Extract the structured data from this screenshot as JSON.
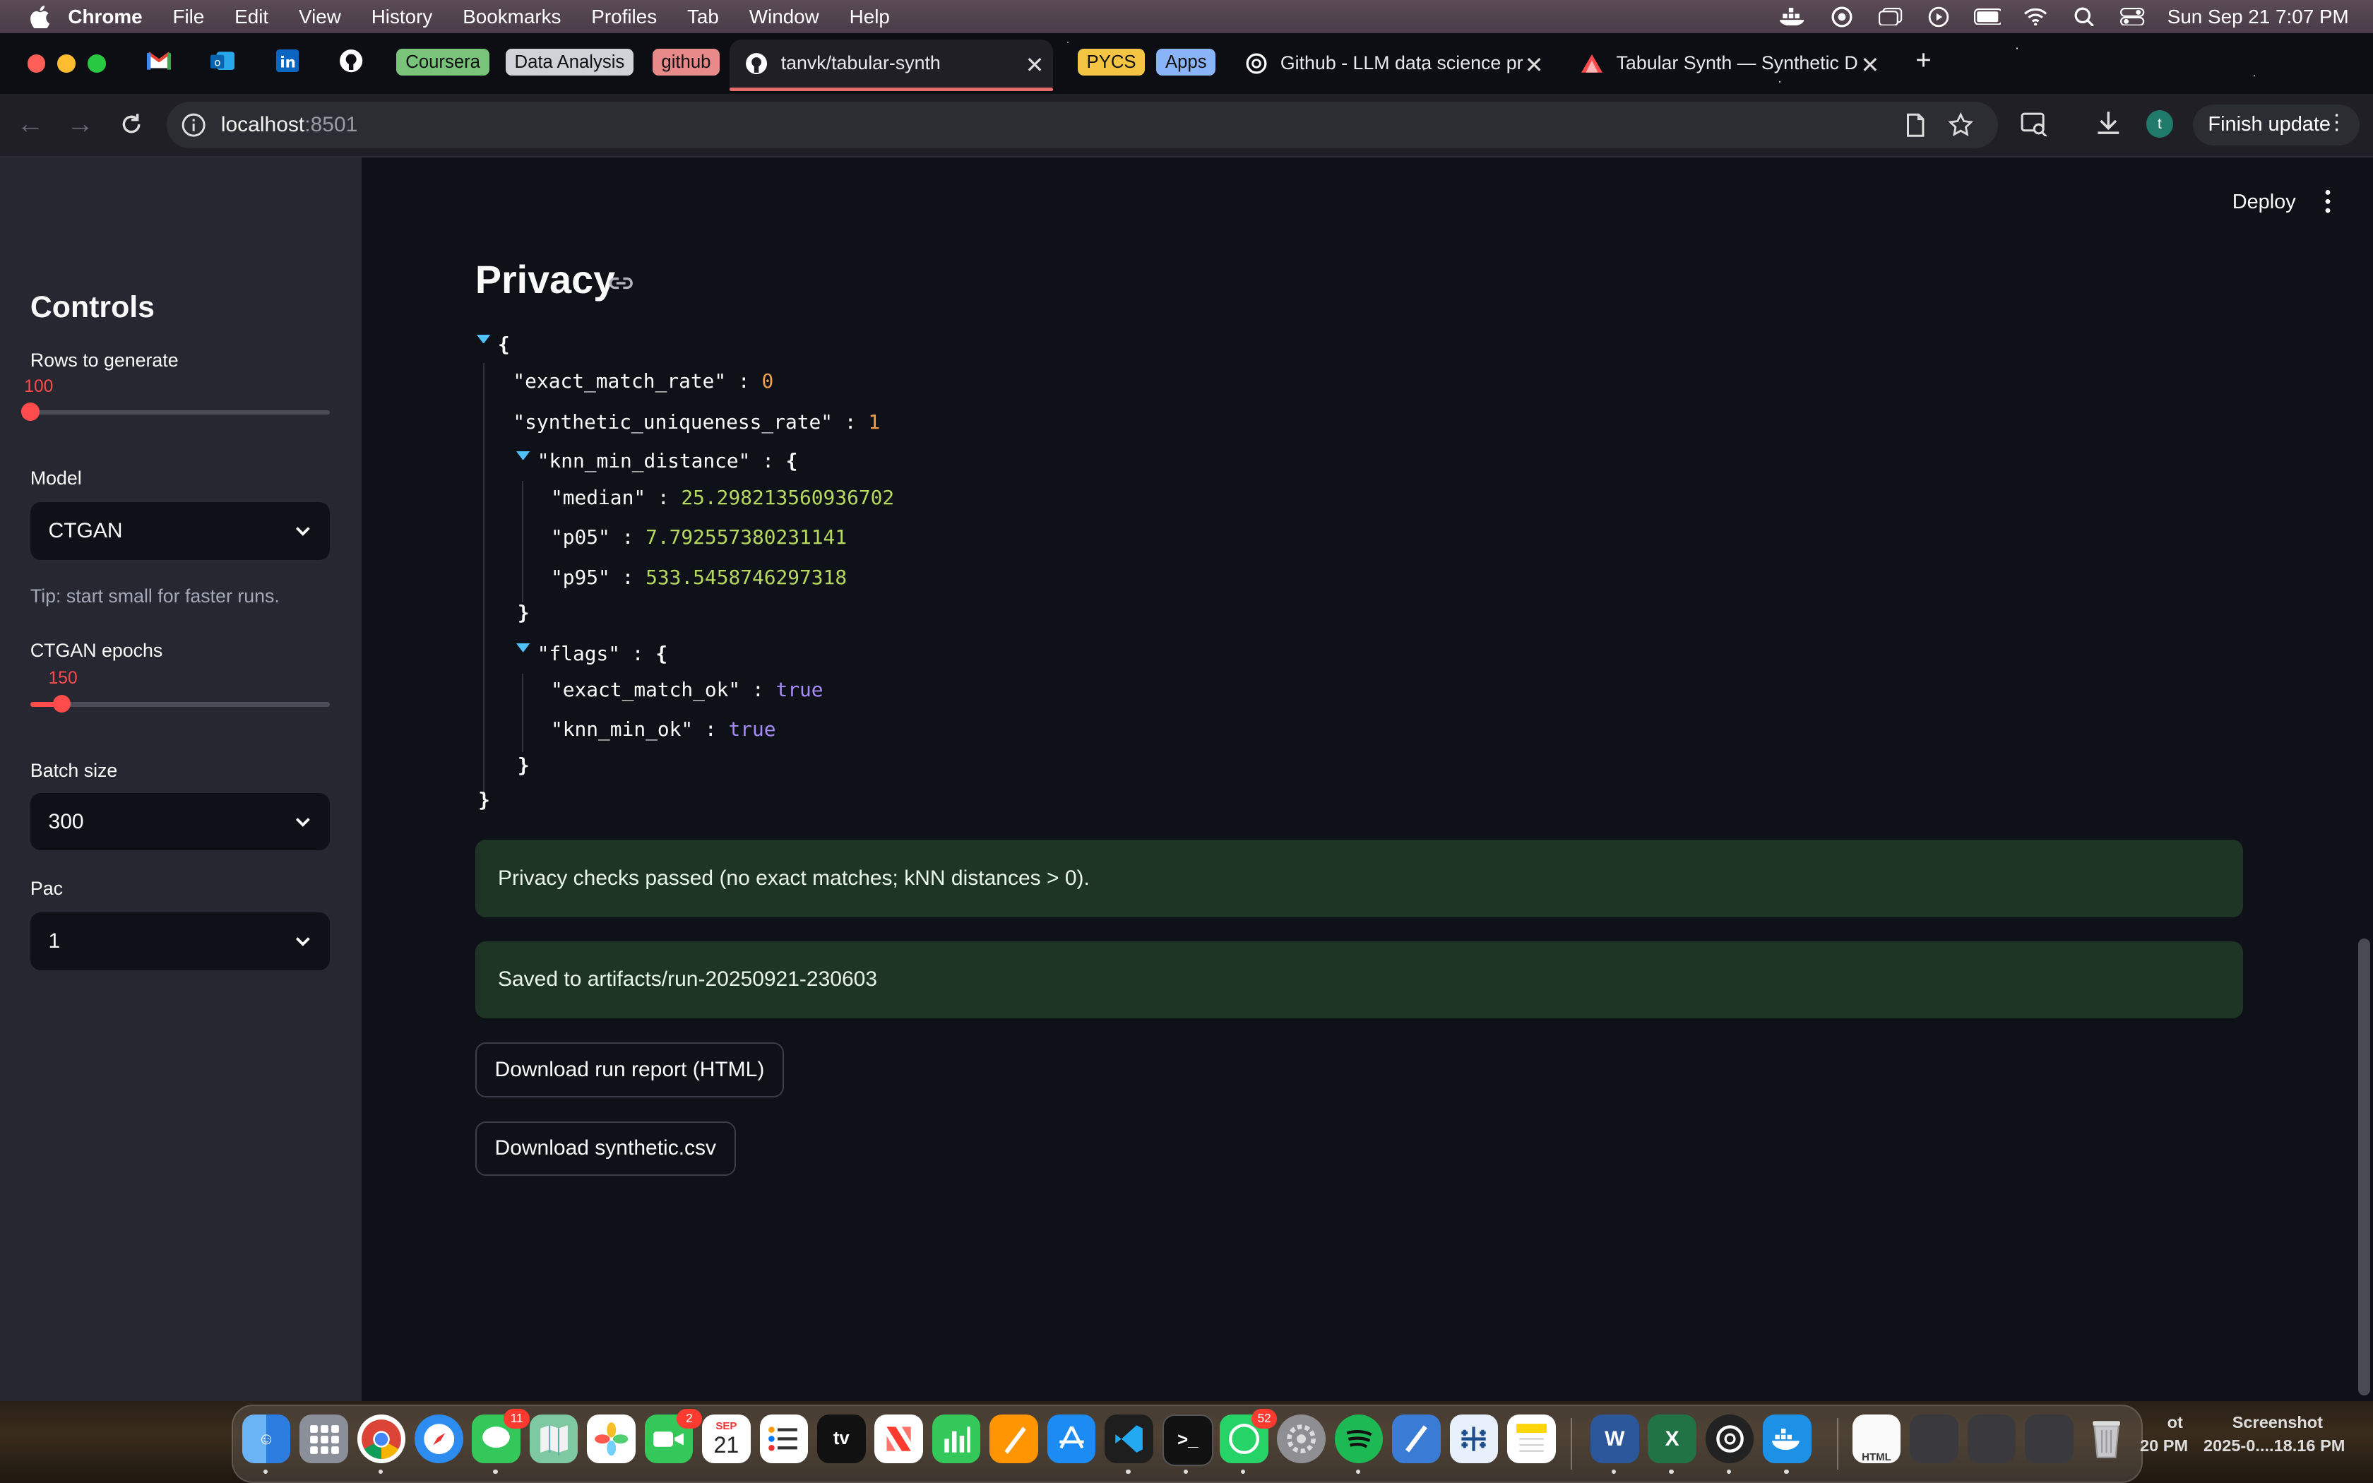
{
  "menubar": {
    "app_name": "Chrome",
    "items": [
      "File",
      "Edit",
      "View",
      "History",
      "Bookmarks",
      "Profiles",
      "Tab",
      "Window",
      "Help"
    ],
    "datetime": "Sun Sep 21  7:07 PM"
  },
  "tabs": {
    "groups": [
      {
        "label": "Coursera",
        "color": "#79c47a"
      },
      {
        "label": "Data Analysis",
        "color": "#cfd3d8"
      },
      {
        "label": "github",
        "color": "#e88a8a"
      },
      {
        "label": "PYCS",
        "color": "#f4c542"
      },
      {
        "label": "Apps",
        "color": "#8ab4f8"
      }
    ],
    "items": [
      {
        "label": "tanvk/tabular-synth"
      },
      {
        "label": "Github - LLM data science pr"
      },
      {
        "label": "Tabular Synth — Synthetic D"
      }
    ]
  },
  "address": {
    "host": "localhost",
    "port": ":8501",
    "finish_update": "Finish update",
    "profile_initial": "t"
  },
  "sidebar": {
    "title": "Controls",
    "rows_label": "Rows to generate",
    "rows_value": "100",
    "rows_fraction": 0.0,
    "model_label": "Model",
    "model_value": "CTGAN",
    "tip": "Tip: start small for faster runs.",
    "epochs_label": "CTGAN epochs",
    "epochs_value": "150",
    "epochs_fraction": 0.105,
    "batch_label": "Batch size",
    "batch_value": "300",
    "pac_label": "Pac",
    "pac_value": "1"
  },
  "main": {
    "deploy": "Deploy",
    "heading": "Privacy",
    "json": {
      "open_brace": "{",
      "close_brace": "}",
      "exact_match_rate_key": "\"exact_match_rate\"",
      "exact_match_rate_val": "0",
      "uniqueness_key": "\"synthetic_uniqueness_rate\"",
      "uniqueness_val": "1",
      "knn_key": "\"knn_min_distance\"",
      "median_key": "\"median\"",
      "median_val": "25.298213560936702",
      "p05_key": "\"p05\"",
      "p05_val": "7.792557380231141",
      "p95_key": "\"p95\"",
      "p95_val": "533.5458746297318",
      "flags_key": "\"flags\"",
      "exact_ok_key": "\"exact_match_ok\"",
      "exact_ok_val": "true",
      "knn_ok_key": "\"knn_min_ok\"",
      "knn_ok_val": "true",
      "colon": ":"
    },
    "alert_privacy": "Privacy checks passed (no exact matches; kNN distances > 0).",
    "alert_saved": "Saved to artifacts/run-20250921-230603",
    "btn_report": "Download run report (HTML)",
    "btn_csv": "Download synthetic.csv"
  },
  "dock": {
    "messages_badge": "11",
    "calendar_month": "SEP",
    "calendar_day": "21",
    "facetime_badge": "2",
    "whatsapp_badge": "52",
    "desktop_label_1": "ot",
    "desktop_label_2": "20 PM",
    "desktop_label_3": "Screenshot",
    "desktop_label_4": "2025-0....18.16 PM"
  }
}
